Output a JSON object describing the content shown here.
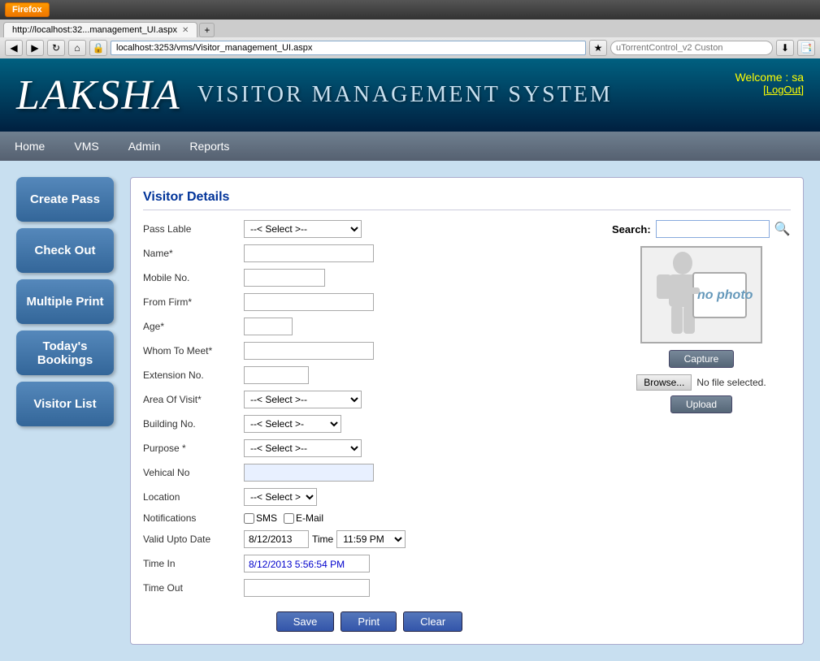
{
  "browser": {
    "firefox_label": "Firefox",
    "tab_title": "http://localhost:32...management_UI.aspx",
    "url": "localhost:3253/vms/Visitor_management_UI.aspx",
    "search_placeholder": "uTorrentControl_v2 Custon"
  },
  "header": {
    "logo": "LAKSHA",
    "title": "VISITOR MANAGEMENT SYSTEM",
    "welcome": "Welcome :  sa",
    "logout": "[LogOut]"
  },
  "nav": {
    "items": [
      "Home",
      "VMS",
      "Admin",
      "Reports"
    ]
  },
  "sidebar": {
    "buttons": [
      "Create Pass",
      "Check Out",
      "Multiple Print",
      "Today's Bookings",
      "Visitor List"
    ]
  },
  "panel": {
    "title": "Visitor Details",
    "search_label": "Search:",
    "search_placeholder": "",
    "fields": {
      "pass_label": "Pass Lable",
      "name": "Name*",
      "mobile": "Mobile No.",
      "from_firm": "From Firm*",
      "age": "Age*",
      "whom_to_meet": "Whom To Meet*",
      "extension_no": "Extension No.",
      "area_of_visit": "Area Of Visit*",
      "building_no": "Building No.",
      "purpose": "Purpose *",
      "vehical_no": "Vehical No",
      "location": "Location",
      "notifications": "Notifications",
      "valid_upto_date": "Valid Upto Date",
      "time_in": "Time In",
      "time_out": "Time Out"
    },
    "select_options": [
      "--< Select >--"
    ],
    "building_select": "--< Select >-",
    "location_select": "--< Select >--",
    "sms_label": "SMS",
    "email_label": "E-Mail",
    "valid_date": "8/12/2013",
    "time_label": "Time",
    "time_value": "11:59 PM",
    "time_in_value": "8/12/2013 5:56:54 PM",
    "no_photo": "no photo",
    "capture_btn": "Capture",
    "browse_btn": "Browse...",
    "file_label": "No file selected.",
    "upload_btn": "Upload",
    "save_btn": "Save",
    "print_btn": "Print",
    "clear_btn": "Clear"
  }
}
